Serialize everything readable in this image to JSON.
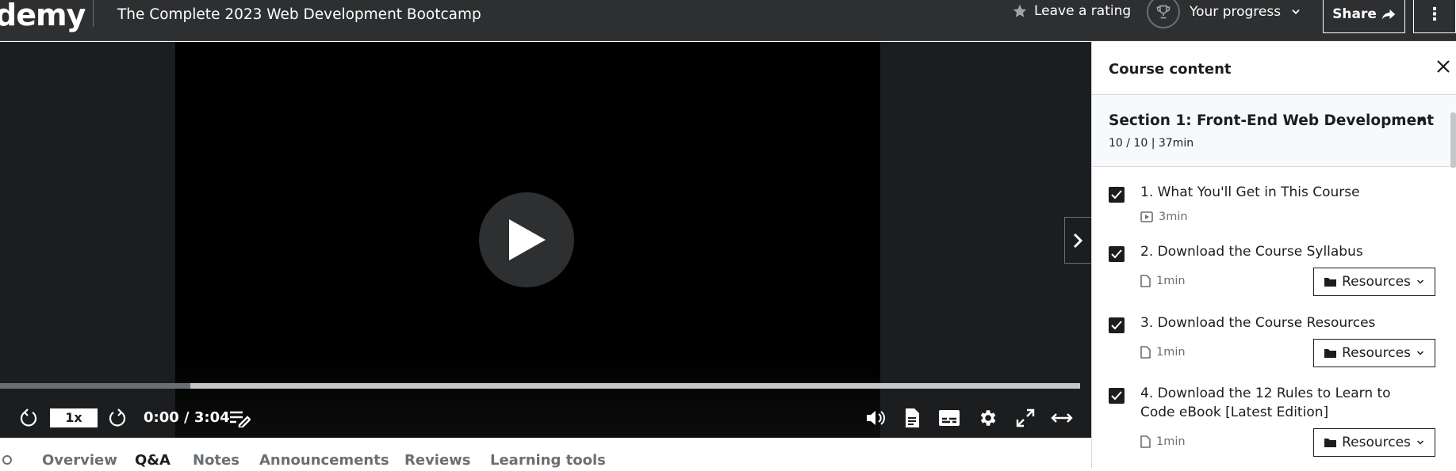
{
  "header": {
    "logo": "demy",
    "course_title": "The Complete 2023 Web Development Bootcamp",
    "rating_label": "Leave a rating",
    "progress_label": "Your progress",
    "share_label": "Share",
    "more_icon": "kebab-icon"
  },
  "player": {
    "speed": "1x",
    "time": "0:00 / 3:04",
    "played_fraction": 0.176
  },
  "tabs": [
    {
      "label": "Overview",
      "active": false
    },
    {
      "label": "Q&A",
      "active": true
    },
    {
      "label": "Notes",
      "active": false
    },
    {
      "label": "Announcements",
      "active": false
    },
    {
      "label": "Reviews",
      "active": false
    },
    {
      "label": "Learning tools",
      "active": false
    }
  ],
  "sidebar": {
    "title": "Course content",
    "section": {
      "title": "Section 1: Front-End Web Development",
      "meta": "10 / 10 | 37min"
    },
    "lectures": [
      {
        "title": "1. What You'll Get in This Course",
        "duration": "3min",
        "type": "video",
        "resources": null,
        "checked": true
      },
      {
        "title": "2. Download the Course Syllabus",
        "duration": "1min",
        "type": "file",
        "resources": "Resources",
        "checked": true
      },
      {
        "title": "3. Download the Course Resources",
        "duration": "1min",
        "type": "file",
        "resources": "Resources",
        "checked": true
      },
      {
        "title": "4. Download the 12 Rules to Learn to Code eBook [Latest Edition]",
        "duration": "1min",
        "type": "file",
        "resources": "Resources",
        "checked": true
      }
    ]
  },
  "colors": {
    "topbar": "#2d2f31",
    "player_bg": "#1c1d1f",
    "text_dark": "#1c1d1f",
    "text_muted": "#6a6f73"
  }
}
